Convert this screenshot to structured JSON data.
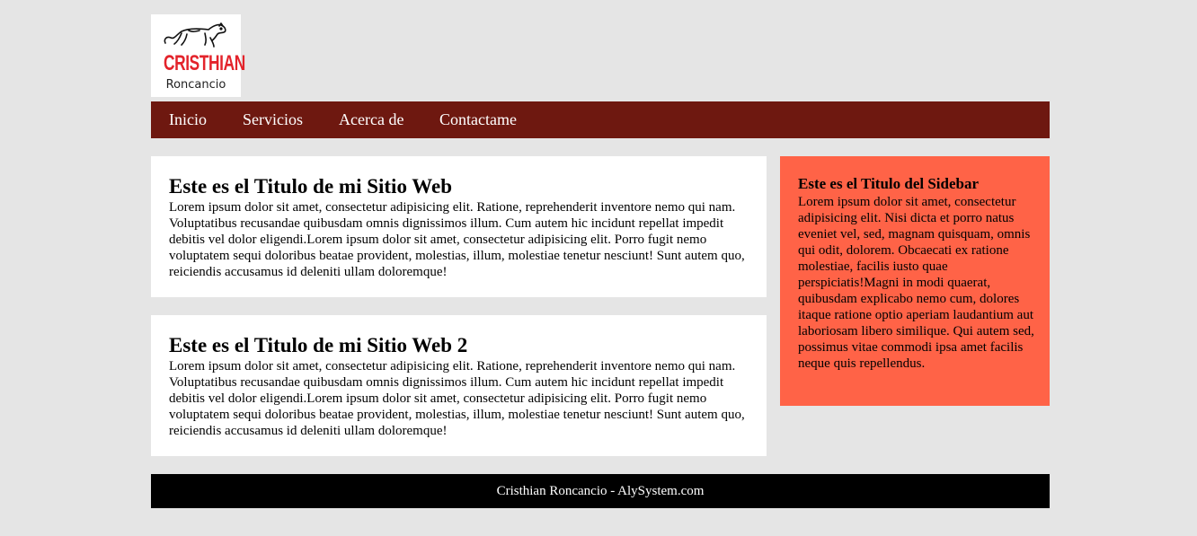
{
  "logo": {
    "title": "CRISTHIAN",
    "subtitle": "Roncancio",
    "icon": "panther-icon",
    "title_color": "#e3232b"
  },
  "nav": {
    "background": "#6e1810",
    "items": [
      {
        "label": "Inicio"
      },
      {
        "label": "Servicios"
      },
      {
        "label": "Acerca de"
      },
      {
        "label": "Contactame"
      }
    ]
  },
  "main": {
    "articles": [
      {
        "title": "Este es el Titulo de mi Sitio Web",
        "body": "Lorem ipsum dolor sit amet, consectetur adipisicing elit. Ratione, reprehenderit inventore nemo qui nam. Voluptatibus recusandae quibusdam omnis dignissimos illum. Cum autem hic incidunt repellat impedit debitis vel dolor eligendi.Lorem ipsum dolor sit amet, consectetur adipisicing elit. Porro fugit nemo voluptatem sequi doloribus beatae provident, molestias, illum, molestiae tenetur nesciunt! Sunt autem quo, reiciendis accusamus id deleniti ullam doloremque!"
      },
      {
        "title": "Este es el Titulo de mi Sitio Web 2",
        "body": "Lorem ipsum dolor sit amet, consectetur adipisicing elit. Ratione, reprehenderit inventore nemo qui nam. Voluptatibus recusandae quibusdam omnis dignissimos illum. Cum autem hic incidunt repellat impedit debitis vel dolor eligendi.Lorem ipsum dolor sit amet, consectetur adipisicing elit. Porro fugit nemo voluptatem sequi doloribus beatae provident, molestias, illum, molestiae tenetur nesciunt! Sunt autem quo, reiciendis accusamus id deleniti ullam doloremque!"
      }
    ]
  },
  "sidebar": {
    "title": "Este es el Titulo del Sidebar",
    "body": "Lorem ipsum dolor sit amet, consectetur adipisicing elit. Nisi dicta et porro natus eveniet vel, sed, magnam quisquam, omnis qui odit, dolorem. Obcaecati ex ratione molestiae, facilis iusto quae perspiciatis!Magni in modi quaerat, quibusdam explicabo nemo cum, dolores itaque ratione optio aperiam laudantium aut laboriosam libero similique. Qui autem sed, possimus vitae commodi ipsa amet facilis neque quis repellendus.",
    "background": "#ff6347"
  },
  "footer": {
    "text": "Cristhian Roncancio - AlySystem.com"
  }
}
